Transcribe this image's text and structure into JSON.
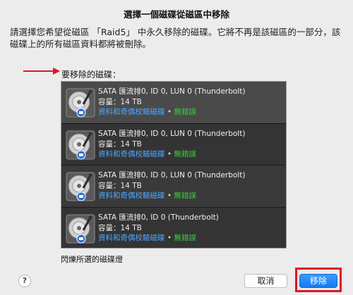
{
  "dialog": {
    "title": "選擇一個磁碟從磁區中移除",
    "description": "請選擇您希望從磁區 「Raid5」 中永久移除的磁碟。它將不再是該磁區的一部分，該磁碟上的所有磁區資料都將被刪除。",
    "list_label": "要移除的磁碟：",
    "blink_label": "閃爍所選的磁碟燈",
    "help_label": "?",
    "cancel_label": "取消",
    "remove_label": "移除"
  },
  "disks": [
    {
      "name": "SATA 匯流排0, ID 0, LUN 0 (Thunderbolt)",
      "capacity": "容量：14 TB",
      "raid_status": "資料和奇偶校驗磁碟",
      "separator": "•",
      "health": "無錯誤"
    },
    {
      "name": "SATA 匯流排0, ID 0, LUN 0 (Thunderbolt)",
      "capacity": "容量：14 TB",
      "raid_status": "資料和奇偶校驗磁碟",
      "separator": "•",
      "health": "無錯誤"
    },
    {
      "name": "SATA 匯流排0, ID 0, LUN 0 (Thunderbolt)",
      "capacity": "容量：14 TB",
      "raid_status": "資料和奇偶校驗磁碟",
      "separator": "•",
      "health": "無錯誤"
    },
    {
      "name": "SATA 匯流排0, ID 0 (Thunderbolt)",
      "capacity": "容量：14 TB",
      "raid_status": "資料和奇偶校驗磁碟",
      "separator": "•",
      "health": "無錯誤"
    }
  ],
  "colors": {
    "raid_status": "#4fa7ff",
    "health_ok": "#3ecb3e",
    "highlight": "#e0161e",
    "primary_button": "#1479f0"
  },
  "icons": {
    "disk": "hard-drive-icon",
    "arrow": "red-arrow-icon"
  }
}
